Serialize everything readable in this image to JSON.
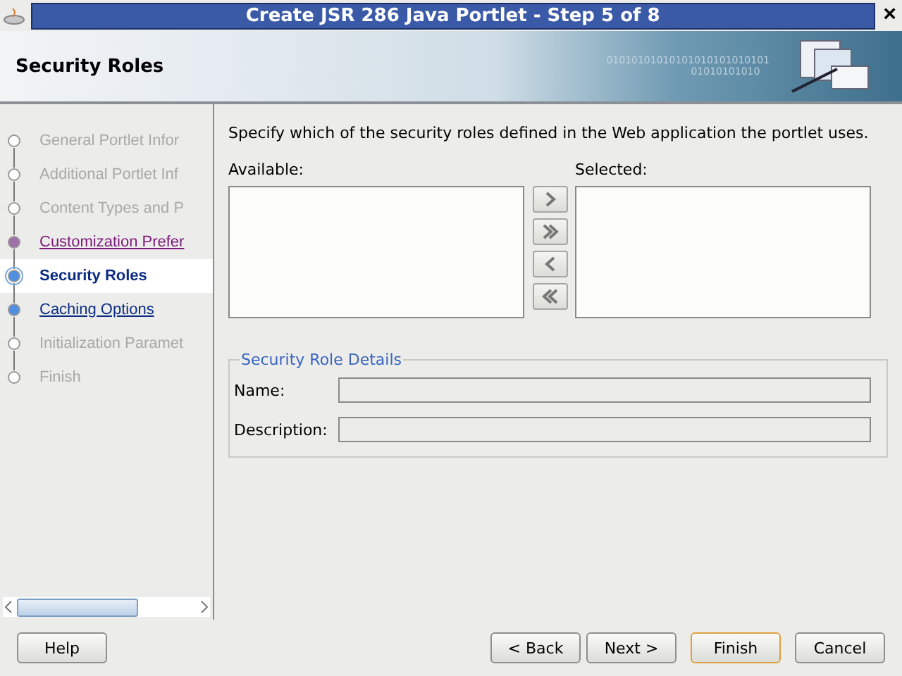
{
  "window": {
    "title": "Create JSR 286 Java Portlet - Step 5 of 8",
    "close": "×"
  },
  "header": {
    "title": "Security Roles",
    "banner_text": [
      "01010101010101010101010101",
      "01010101010"
    ]
  },
  "steps": [
    {
      "label": "General Portlet Infor",
      "kind": "disabled",
      "selected": false
    },
    {
      "label": "Additional Portlet Inf",
      "kind": "disabled",
      "selected": false
    },
    {
      "label": "Content Types and P",
      "kind": "disabled",
      "selected": false
    },
    {
      "label": "Customization Prefer",
      "kind": "visited",
      "selected": false
    },
    {
      "label": "Security Roles",
      "kind": "current",
      "selected": true
    },
    {
      "label": "Caching Options",
      "kind": "link",
      "selected": false
    },
    {
      "label": "Initialization Paramet",
      "kind": "disabled",
      "selected": false
    },
    {
      "label": "Finish",
      "kind": "disabled",
      "selected": false
    }
  ],
  "content": {
    "instruction": "Specify which of the security roles defined in the Web application the portlet uses.",
    "available_label": "Available:",
    "selected_label": "Selected:",
    "shuttle_buttons": [
      {
        "kind": "add"
      },
      {
        "kind": "add_all"
      },
      {
        "kind": "remove"
      },
      {
        "kind": "remove_all"
      }
    ],
    "details": {
      "legend": "Security Role Details",
      "fields": [
        {
          "label": "Name:"
        },
        {
          "label": "Description:"
        }
      ]
    }
  },
  "buttons": {
    "help": "Help",
    "back": "< Back",
    "next": "Next >",
    "finish": "Finish",
    "cancel": "Cancel"
  }
}
